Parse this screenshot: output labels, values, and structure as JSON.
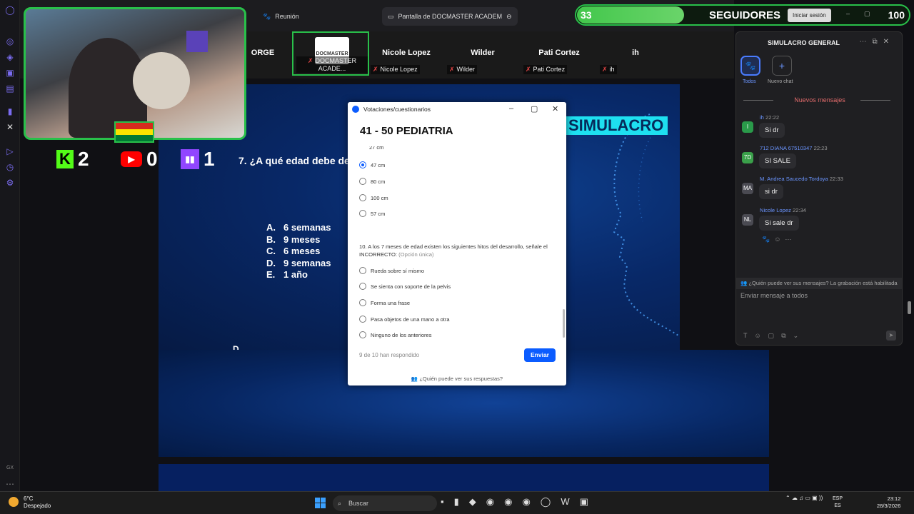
{
  "window": {
    "tab_meeting": "Reunión",
    "tab_share": "Pantalla de DOCMASTER ACADEM"
  },
  "participants": [
    {
      "name": "ORGE",
      "tag": ""
    },
    {
      "name": "",
      "tag": "DOCMASTER ACADE...",
      "logo": "DOCMASTER"
    },
    {
      "name": "Nicole Lopez",
      "tag": "Nicole Lopez"
    },
    {
      "name": "Wilder",
      "tag": "Wilder"
    },
    {
      "name": "Pati Cortez",
      "tag": "Pati Cortez"
    },
    {
      "name": "ih",
      "tag": "ih"
    }
  ],
  "slide": {
    "banner": "SIMULACRO",
    "question": "7. ¿A qué edad debe desa",
    "options": [
      {
        "letter": "A.",
        "text": "6 semanas"
      },
      {
        "letter": "B.",
        "text": "9 meses"
      },
      {
        "letter": "C.",
        "text": "6 meses"
      },
      {
        "letter": "D.",
        "text": "9 semanas"
      },
      {
        "letter": "E.",
        "text": "1 año"
      }
    ],
    "cut_text": "D. ..."
  },
  "stream_counts": {
    "kick": "2",
    "youtube": "0",
    "twitch": "1"
  },
  "followers": {
    "current": "33",
    "label": "SEGUIDORES",
    "login": "Iniciar sesión",
    "goal": "100",
    "progress": 0.33
  },
  "quiz": {
    "window_title": "Votaciones/cuestionarios",
    "heading": "41 - 50 PEDIATRIA",
    "cut_option": "27 cm",
    "q9_options": [
      {
        "label": "47 cm",
        "selected": true
      },
      {
        "label": "80 cm",
        "selected": false
      },
      {
        "label": "100 cm",
        "selected": false
      },
      {
        "label": "57 cm",
        "selected": false
      }
    ],
    "q10_text": "10. A los 7 meses de edad existen los siguientes hitos del desarrollo, señale el INCORRECTO:",
    "q10_hint": "(Opción única)",
    "q10_options": [
      "Rueda sobre sí mismo",
      "Se sienta con soporte de la pelvis",
      "Forma una frase",
      "Pasa objetos de una mano a otra",
      "Ninguno de los anteriores"
    ],
    "answered": "9 de 10 han respondido",
    "send": "Enviar",
    "who_sees": "¿Quién puede ver sus respuestas?"
  },
  "chat": {
    "title": "SIMULACRO GENERAL",
    "all_label": "Todos",
    "new_chat_label": "Nuevo chat",
    "new_messages": "Nuevos mensajes",
    "messages": [
      {
        "initials": "I",
        "name": "ih",
        "time": "22:22",
        "text": "Si dr",
        "color": "#2a9a4a"
      },
      {
        "initials": "7D",
        "name": "712 DIANA 67510347",
        "time": "22:23",
        "text": "SI SALE",
        "color": "#3aa04a"
      },
      {
        "initials": "MA",
        "name": "M. Andrea Saucedo Tordoya",
        "time": "22:33",
        "text": "si dr",
        "color": "#4a4a52"
      },
      {
        "initials": "NL",
        "name": "Nicole Lopez",
        "time": "22:34",
        "text": "Si sale dr",
        "color": "#4a4a52"
      }
    ],
    "privacy_note": "¿Quién puede ver sus mensajes? La grabación está habilitada",
    "input_placeholder": "Enviar mensaje a todos"
  },
  "taskbar": {
    "temp": "6°C",
    "weather": "Despejado",
    "search": "Buscar",
    "lang1": "ESP",
    "lang2": "ES",
    "time": "23:12",
    "date": "28/3/2026"
  }
}
